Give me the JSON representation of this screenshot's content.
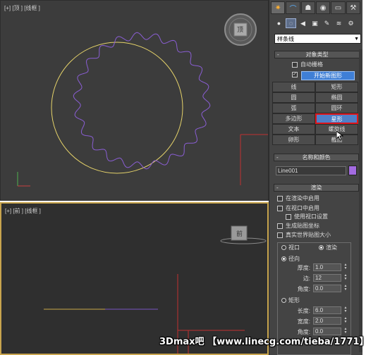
{
  "viewports": {
    "top": {
      "label": "[+] [顶 ] [线框 ]",
      "cube_face": "顶"
    },
    "front": {
      "label": "[+] [前 ] [线框 ]",
      "cube_face": "前"
    }
  },
  "panel": {
    "tabs": [
      "sun-icon",
      "curve-icon",
      "hierarchy-icon",
      "motion-icon",
      "display-icon",
      "wrench-icon"
    ],
    "subtabs": [
      "geometry-icon",
      "shapes-icon",
      "lights-icon",
      "cameras-icon",
      "helpers-icon",
      "spacewarps-icon",
      "systems-icon"
    ],
    "category": "样条线",
    "object_type": {
      "title": "对象类型",
      "auto_grid": "自动栅格",
      "start_new_shape": "开始新图形",
      "buttons": [
        "线",
        "矩形",
        "圆",
        "椭圆",
        "弧",
        "圆环",
        "多边形",
        "星形",
        "文本",
        "螺旋线",
        "卵形",
        "截面"
      ]
    },
    "name_color": {
      "title": "名称和颜色",
      "name": "Line001",
      "color": "#a36be0"
    },
    "rendering": {
      "title": "渲染",
      "enable_in_renderer": "在渲染中启用",
      "enable_in_viewport": "在视口中启用",
      "use_viewport_settings": "使用视口设置",
      "generate_mapping": "生成贴图坐标",
      "real_world_map_size": "真实世界贴图大小",
      "viewport_radio": "视口",
      "renderer_radio": "渲染",
      "radial": "径向",
      "thickness_label": "厚度:",
      "thickness": "1.0",
      "sides_label": "边:",
      "sides": "12",
      "angle_label": "角度:",
      "angle": "0.0",
      "rectangular": "矩形",
      "length_label": "长度:",
      "length": "6.0",
      "width_label": "宽度:",
      "width": "2.0",
      "angle2_label": "角度:",
      "angle2": "0.0"
    }
  },
  "watermark": "3Dmax吧 【www.linecg.com/tieba/1771】",
  "colors": {
    "accent": "#3f7fd6",
    "highlight": "#e0161b",
    "circle": "#e6d36a",
    "star": "#8a5ed4"
  }
}
